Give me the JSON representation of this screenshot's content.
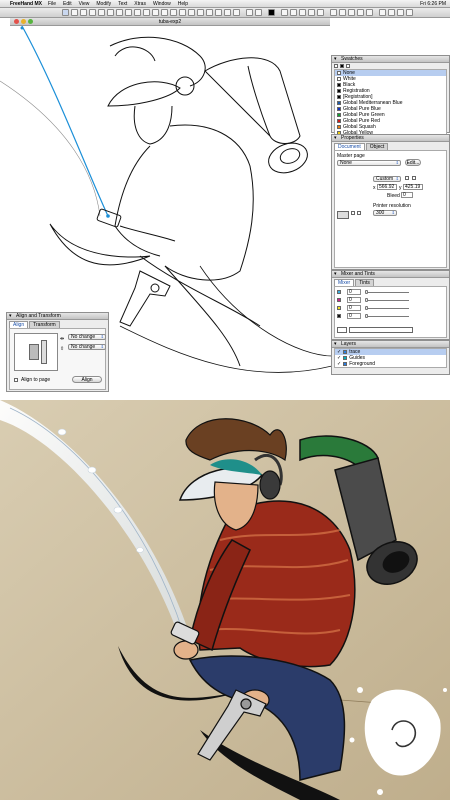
{
  "app": {
    "name": "FreeHand MX",
    "menus": [
      "File",
      "Edit",
      "View",
      "Modify",
      "Text",
      "Xtras",
      "Window",
      "Help"
    ],
    "clock": "Fri 6:26 PM",
    "document_title": "tuba-exp2"
  },
  "swatches": {
    "title": "Swatches",
    "items": [
      {
        "name": "None",
        "color": "#ffffff"
      },
      {
        "name": "White",
        "color": "#ffffff"
      },
      {
        "name": "Black",
        "color": "#000000"
      },
      {
        "name": "Registration",
        "color": "#000000"
      },
      {
        "name": "[Registration]",
        "color": "#000000"
      },
      {
        "name": "Global Mediterranean Blue",
        "color": "#1b5aa8"
      },
      {
        "name": "Global Pure Blue",
        "color": "#1030c0"
      },
      {
        "name": "Global Pure Green",
        "color": "#10a030"
      },
      {
        "name": "Global Pure Red",
        "color": "#d01818"
      },
      {
        "name": "Global Squash",
        "color": "#e88010"
      },
      {
        "name": "Global Yellow",
        "color": "#f0d010"
      }
    ]
  },
  "properties": {
    "title": "Properties",
    "tabs": [
      "Document",
      "Object"
    ],
    "master_page_label": "Master page",
    "master_page_value": "None",
    "edit_button": "Edit...",
    "page_size": "Custom",
    "x_label": "x",
    "x_value": "566.92",
    "y_label": "y",
    "y_value": "425.19",
    "bleed_label": "Bleed",
    "bleed_value": "0",
    "printer_resolution_label": "Printer resolution",
    "printer_resolution_value": "300"
  },
  "mixer": {
    "title": "Mixer and Tints",
    "tabs": [
      "Mixer",
      "Tints"
    ],
    "values": [
      "0",
      "0",
      "0",
      "0"
    ]
  },
  "layers": {
    "title": "Layers",
    "items": [
      {
        "name": "trace",
        "color": "#2a7de0",
        "selected": true
      },
      {
        "name": "Guides",
        "color": "#00b0c0",
        "selected": false
      },
      {
        "name": "Foreground",
        "color": "#2a7de0",
        "selected": false
      }
    ]
  },
  "align": {
    "title": "Align and Transform",
    "tabs": [
      "Align",
      "Transform"
    ],
    "horizontal": "No change",
    "vertical": "No change",
    "align_to_page": "Align to page",
    "align_button": "Align"
  },
  "colors": {
    "selection_blue": "#1b8fd8",
    "hoodie_red": "#9a2a1a",
    "jeans_blue": "#2b3c6a",
    "backpack_green": "#2a7a3a",
    "paper_beige": "#c9b99a"
  }
}
